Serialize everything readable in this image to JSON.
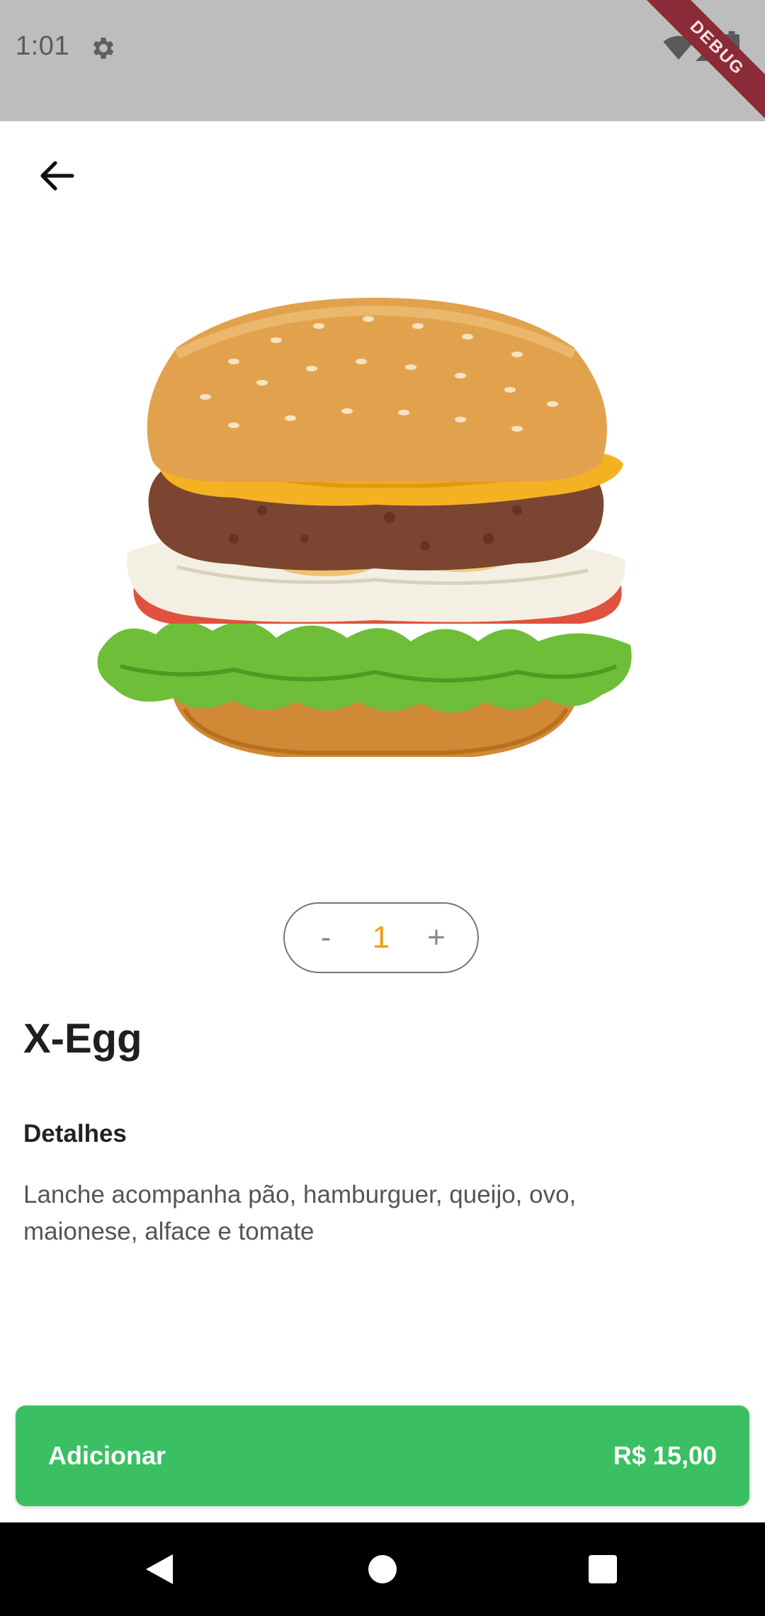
{
  "status_bar": {
    "time": "1:01",
    "icons": [
      "gear-icon",
      "wifi-icon",
      "signal-icon",
      "battery-icon"
    ],
    "debug_label": "DEBUG"
  },
  "header": {
    "back_icon": "arrow-left-icon"
  },
  "product": {
    "image_icon": "burger-image",
    "name": "X-Egg",
    "details_title": "Detalhes",
    "details_text": "Lanche acompanha pão, hamburguer, queijo, ovo, maionese, alface e tomate"
  },
  "quantity": {
    "minus_label": "-",
    "value": "1",
    "plus_label": "+"
  },
  "cart_button": {
    "label": "Adicionar",
    "price": "R$ 15,00"
  },
  "nav_bar": {
    "icons": [
      "back-triangle-icon",
      "home-circle-icon",
      "recents-square-icon"
    ]
  },
  "colors": {
    "accent_green": "#3ac063",
    "quantity_orange": "#f29a16",
    "status_bar_gray": "#bdbdbd",
    "debug_ribbon": "#8a2b37"
  }
}
